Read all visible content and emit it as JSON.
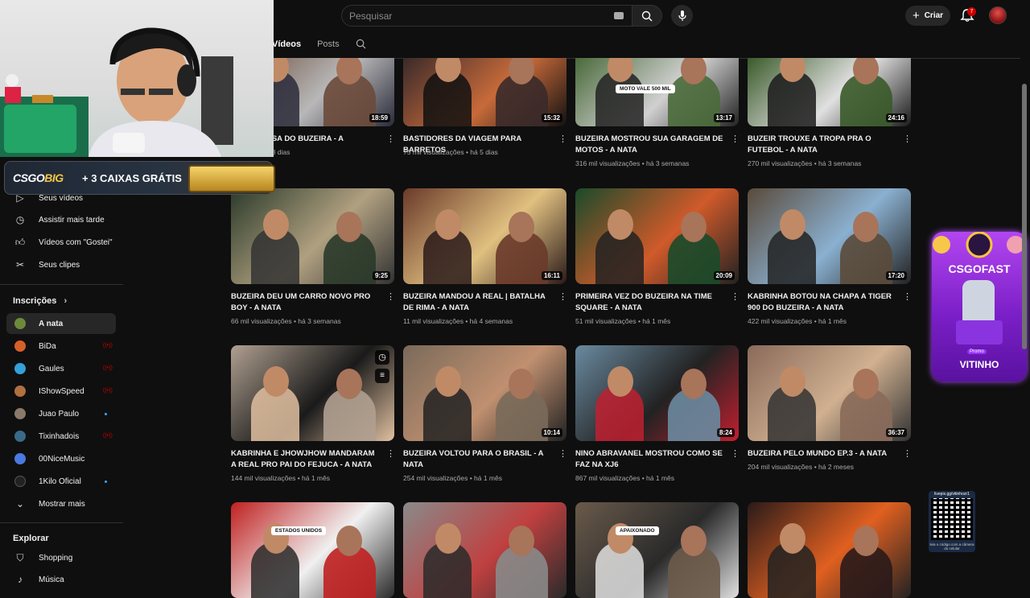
{
  "header": {
    "search_placeholder": "Pesquisar",
    "create_label": "Criar",
    "notifications_count": "7"
  },
  "tabs": [
    {
      "label": "Vídeos"
    },
    {
      "label": "Posts"
    }
  ],
  "sidebar": {
    "top_items": [
      {
        "label": "Seus vídeos",
        "icon": "play-square-icon"
      },
      {
        "label": "Assistir mais tarde",
        "icon": "clock-icon"
      },
      {
        "label": "Vídeos com \"Gostei\"",
        "icon": "thumb-up-icon"
      },
      {
        "label": "Seus clipes",
        "icon": "scissors-icon"
      }
    ],
    "subscriptions_heading": "Inscrições",
    "subscriptions": [
      {
        "name": "A nata",
        "active": true,
        "status": ""
      },
      {
        "name": "BiDa",
        "status": "live"
      },
      {
        "name": "Gaules",
        "status": "live"
      },
      {
        "name": "IShowSpeed",
        "status": "live"
      },
      {
        "name": "Juao Paulo",
        "status": "new"
      },
      {
        "name": "Tixinhadois",
        "status": "live"
      },
      {
        "name": "00NiceMusic",
        "status": ""
      },
      {
        "name": "1Kilo Oficial",
        "status": "new"
      }
    ],
    "show_more": "Mostrar mais",
    "explore_heading": "Explorar",
    "explore_items": [
      {
        "label": "Shopping",
        "icon": "bag-icon"
      },
      {
        "label": "Música",
        "icon": "music-icon"
      }
    ]
  },
  "videos": [
    {
      "title": "FUT NA CASA DO BUZEIRA - A",
      "views": "…ações",
      "age": "há 3 dias",
      "duration": "18:59"
    },
    {
      "title": "BASTIDORES DA VIAGEM PARA BARRETOS",
      "views": "75 mil visualizações",
      "age": "há 5 dias",
      "duration": "15:32"
    },
    {
      "title": "BUZEIRA MOSTROU SUA GARAGEM DE MOTOS - A NATA",
      "views": "316 mil visualizações",
      "age": "há 3 semanas",
      "duration": "13:17",
      "overlay": "MOTO VALE 500 MIL"
    },
    {
      "title": "BUZEIR TROUXE A TROPA PRA O FUTEBOL - A NATA",
      "views": "270 mil visualizações",
      "age": "há 3 semanas",
      "duration": "24:16"
    },
    {
      "title": "BUZEIRA DEU UM CARRO NOVO PRO BOY - A NATA",
      "views": "66 mil visualizações",
      "age": "há 3 semanas",
      "duration": "9:25"
    },
    {
      "title": "BUZEIRA MANDOU A REAL | BATALHA DE RIMA - A NATA",
      "views": "11 mil visualizações",
      "age": "há 4 semanas",
      "duration": "16:11"
    },
    {
      "title": "PRIMEIRA VEZ DO BUZEIRA NA TIME SQUARE - A NATA",
      "views": "51 mil visualizações",
      "age": "há 1 mês",
      "duration": "20:09"
    },
    {
      "title": "KABRINHA BOTOU NA CHAPA A TIGER 900 DO BUZEIRA - A NATA",
      "views": "422 mil visualizações",
      "age": "há 1 mês",
      "duration": "17:20"
    },
    {
      "title": "KABRINHA E JHOWJHOW MANDARAM A REAL PRO PAI DO FEJUCA - A NATA",
      "views": "144 mil visualizações",
      "age": "há 1 mês",
      "duration": ""
    },
    {
      "title": "BUZEIRA VOLTOU PARA O BRASIL - A NATA",
      "views": "254 mil visualizações",
      "age": "há 1 mês",
      "duration": "10:14"
    },
    {
      "title": "NINO ABRAVANEL MOSTROU COMO SE FAZ NA XJ6",
      "views": "867 mil visualizações",
      "age": "há 1 mês",
      "duration": "8:24"
    },
    {
      "title": "BUZEIRA PELO MUNDO EP.3 - A NATA",
      "views": "204 mil visualizações",
      "age": "há 2 meses",
      "duration": "36:37"
    },
    {
      "title": "",
      "views": "",
      "age": "",
      "duration": "",
      "overlay": "ESTADOS UNIDOS"
    },
    {
      "title": "",
      "views": "",
      "age": "",
      "duration": ""
    },
    {
      "title": "",
      "views": "",
      "age": "",
      "duration": "",
      "overlay": "APAIXONADO"
    },
    {
      "title": "",
      "views": "",
      "age": "",
      "duration": ""
    }
  ],
  "overlays": {
    "banner_logo_a": "CSGO",
    "banner_logo_b": "BIG",
    "banner_promo": "+ 3 CAIXAS GRÁTIS",
    "csgofast_title": "CSGOFAST",
    "csgofast_code": "VITINHO",
    "csgofast_promo": "Promo",
    "qr_url": "livepix.gg/vitinhozr1",
    "qr_caption": "leia o código com a câmera do celular"
  },
  "colors": {
    "background": "#0f0f0f",
    "accent_red": "#cc0000",
    "csgofast_purple": "#9b30ff"
  }
}
